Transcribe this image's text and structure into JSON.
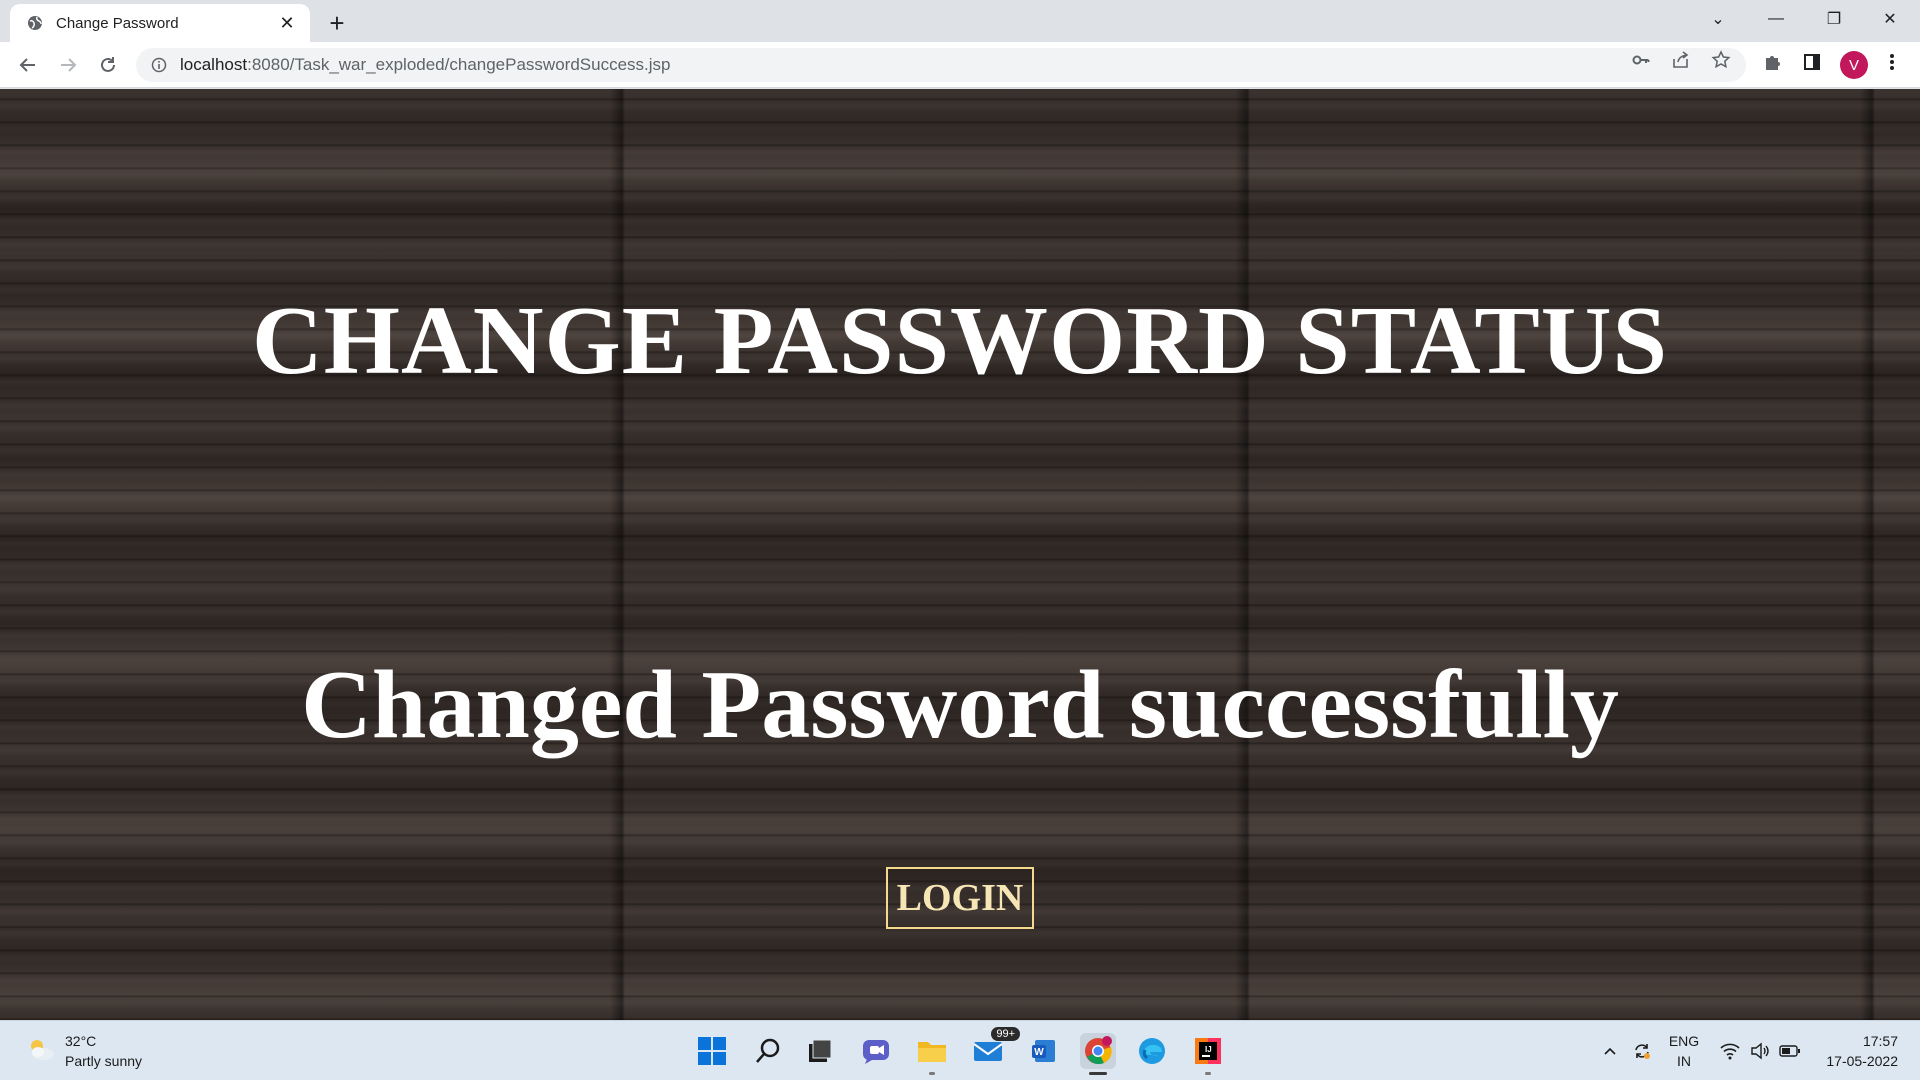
{
  "browser": {
    "tab_title": "Change Password",
    "url_host": "localhost",
    "url_rest": ":8080/Task_war_exploded/changePasswordSuccess.jsp",
    "profile_initial": "V"
  },
  "page": {
    "title": "CHANGE PASSWORD STATUS",
    "message": "Changed Password successfully",
    "login_label": "LOGIN"
  },
  "taskbar": {
    "weather_temp": "32°C",
    "weather_desc": "Partly sunny",
    "mail_badge": "99+",
    "lang_line1": "ENG",
    "lang_line2": "IN",
    "time": "17:57",
    "date": "17-05-2022"
  },
  "colors": {
    "login_border": "#f5d98c",
    "avatar": "#c2185b",
    "taskbar": "#dde7f1"
  }
}
